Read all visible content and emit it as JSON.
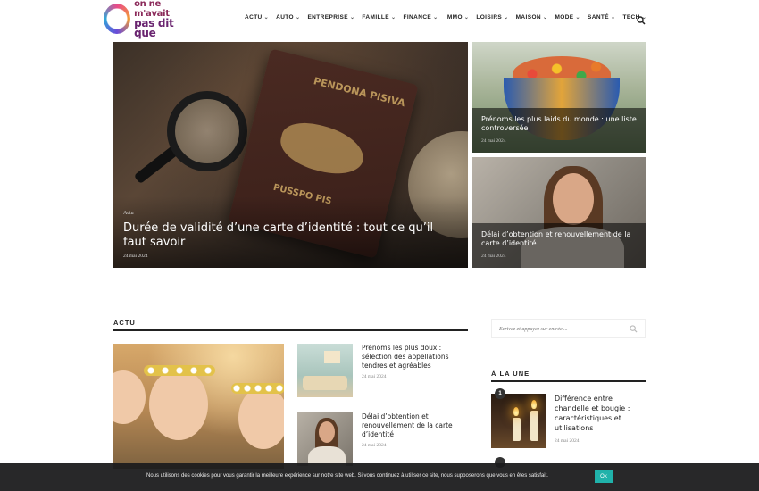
{
  "header": {
    "logo_line1": "on ne m'avait",
    "logo_line2": "pas dit que",
    "nav": [
      {
        "label": "ACTU"
      },
      {
        "label": "AUTO"
      },
      {
        "label": "ENTREPRISE"
      },
      {
        "label": "FAMILLE"
      },
      {
        "label": "FINANCE"
      },
      {
        "label": "IMMO"
      },
      {
        "label": "LOISIRS"
      },
      {
        "label": "MAISON"
      },
      {
        "label": "MODE"
      },
      {
        "label": "SANTÉ"
      },
      {
        "label": "TECH"
      }
    ]
  },
  "hero": {
    "main": {
      "category": "Actu",
      "title": "Durée de validité d’une carte d’identité : tout ce qu’il faut savoir",
      "date": "24 mai 2024",
      "passport_text": "PENDONA PISIVA",
      "passport_text2": "PUSSPO PIS"
    },
    "side": [
      {
        "title": "Prénoms les plus laids du monde : une liste controversée",
        "date": "24 mai 2024"
      },
      {
        "title": "Délai d’obtention et renouvellement de la carte d’identité",
        "date": "24 mai 2024"
      }
    ]
  },
  "actu": {
    "heading": "ACTU",
    "items": [
      {
        "title": "Prénoms les plus doux : sélection des appellations tendres et agréables",
        "date": "24 mai 2024"
      },
      {
        "title": "Délai d’obtention et renouvellement de la carte d’identité",
        "date": "24 mai 2024"
      }
    ]
  },
  "sidebar": {
    "search_placeholder": "Écrivez et appuyez sur entrée ...",
    "heading": "À LA UNE",
    "items": [
      {
        "rank": "1",
        "title": "Différence entre chandelle et bougie : caractéristiques et utilisations",
        "date": "24 mai 2024"
      }
    ]
  },
  "cookie": {
    "text": "Nous utilisons des cookies pour vous garantir la meilleure expérience sur notre site web. Si vous continuez à utiliser ce site, nous supposerons que vous en êtes satisfait.",
    "ok_label": "Ok"
  },
  "colors": {
    "accent": "#20b2aa",
    "cookie_bg": "#1c1c1e"
  },
  "icons": {
    "search": "search-icon",
    "chevron": "chevron-down-icon"
  }
}
